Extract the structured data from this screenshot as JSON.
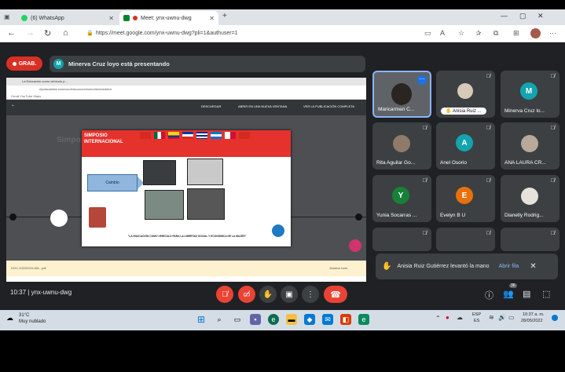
{
  "browser": {
    "tabs": [
      {
        "label": "(6) WhatsApp",
        "icon": "whatsapp-icon"
      },
      {
        "label": "Meet: ynx-uwnu-dwg",
        "icon": "meet-icon"
      }
    ],
    "new_tab": "+",
    "url": "https://meet.google.com/ynx-uwnu-dwg?pli=1&authuser=1"
  },
  "meet": {
    "rec_label": "GRAB.",
    "presenter_initial": "M",
    "presenting_text": "Minerva Cruz loyo está presentando",
    "meeting_time": "10:37",
    "meeting_code": "ynx-uwnu-dwg",
    "participant_count": "36"
  },
  "shared_screen": {
    "tab_title": "La Educación como vehículo p...",
    "url": "elpaiscaletra.com/csm/educacion/index/#embedded",
    "bookmarks": "Gmail   YouTube   Maps",
    "download": "DESCARGAR",
    "open_new_window": "ABRIR EN UNA NUEVA VENTANA",
    "fullscreen": "VER LA PUBLICACIÓN COMPLETA",
    "banner_title": "SIMPOSIO INTERNACIONAL",
    "cambio": "Cambio",
    "footer": "\"LA EDUCACIÓN COMO VEHÍCULO PARA LA LIBERTAD SOCIAL Y ECONÓMICA DE LA MUJER\"",
    "bg_partial": "Simpo",
    "download_file": "DOC-20220224-WA...pdf",
    "download_all": "Mostrar todo"
  },
  "participants": [
    {
      "name": "Maricarmen C...",
      "type": "photo",
      "highlight": true
    },
    {
      "name": "Anisia Ruiz ...",
      "type": "photo",
      "hand": true
    },
    {
      "name": "Minerva Cruz lo...",
      "initial": "M",
      "color": "#12a4af"
    },
    {
      "name": "Rita Aguilar Go...",
      "type": "photo"
    },
    {
      "name": "Anel Osorio",
      "initial": "A",
      "color": "#12a4af"
    },
    {
      "name": "ANA LAURA CR...",
      "type": "photo"
    },
    {
      "name": "Yunia Socarras ...",
      "initial": "Y",
      "color": "#188038"
    },
    {
      "name": "Evelyn B U",
      "initial": "E",
      "color": "#e8710a"
    },
    {
      "name": "Dianelly Rodrig...",
      "type": "photo"
    }
  ],
  "notification": {
    "text": "Anisia Ruiz Gutiérrez levantó la mano",
    "action": "Abrir fila"
  },
  "taskbar": {
    "temp": "31°C",
    "weather": "Muy nublado",
    "lang1": "ESP",
    "lang2": "ES",
    "time": "10:37 a. m.",
    "date": "28/05/2022"
  }
}
